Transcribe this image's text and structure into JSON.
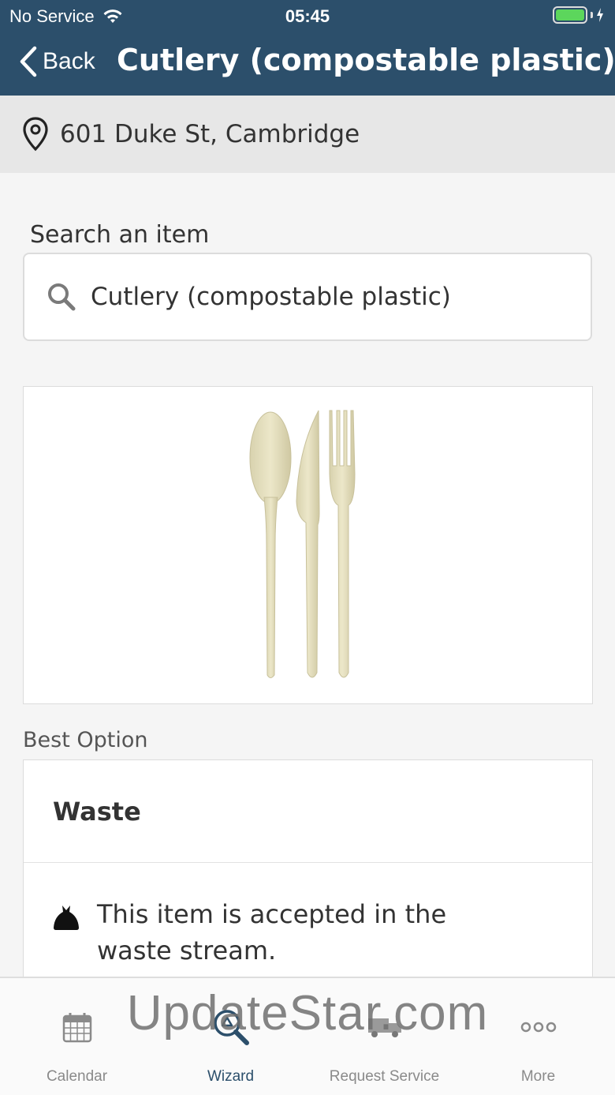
{
  "status_bar": {
    "carrier": "No Service",
    "time": "05:45"
  },
  "nav": {
    "back_label": "Back",
    "title": "Cutlery (compostable plastic)"
  },
  "location": {
    "address": "601 Duke St, Cambridge"
  },
  "search": {
    "label": "Search an item",
    "value": "Cutlery (compostable plastic)"
  },
  "best_option": {
    "label": "Best Option",
    "title": "Waste",
    "line1": "This item is accepted in the",
    "line2": "waste stream."
  },
  "tabs": [
    {
      "label": "Calendar",
      "icon": "calendar-icon"
    },
    {
      "label": "Wizard",
      "icon": "wizard-search-icon"
    },
    {
      "label": "Request Service",
      "icon": "truck-icon"
    },
    {
      "label": "More",
      "icon": "more-dots-icon"
    }
  ],
  "watermark": "UpdateStar.com",
  "colors": {
    "header": "#2c4f6b",
    "active_tab": "#2c4f6b",
    "battery": "#5cd65c"
  }
}
